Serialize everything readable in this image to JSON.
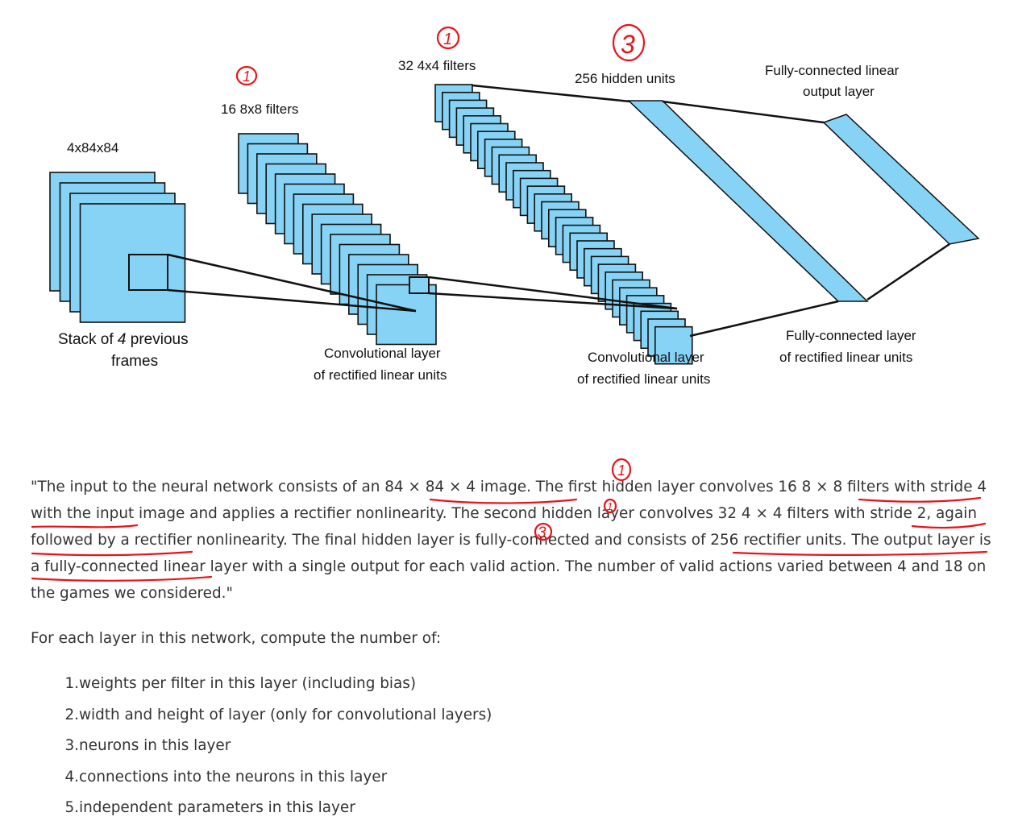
{
  "diagram": {
    "input_size_label": "4x84x84",
    "input_caption_line1_pre": "Stack of ",
    "input_caption_line1_em": "4",
    "input_caption_line1_post": " previous",
    "input_caption_line2": "frames",
    "conv1_filters_label": "16 8x8 filters",
    "conv1_caption_line1": "Convolutional layer",
    "conv1_caption_line2": "of rectified linear units",
    "conv2_filters_label": "32 4x4 filters",
    "conv2_caption_line1": "Convolutional layer",
    "conv2_caption_line2": "of rectified linear units",
    "fc_label": "256 hidden units",
    "fc_caption_line1": "Fully-connected layer",
    "fc_caption_line2": "of rectified linear units",
    "out_label_line1": "Fully-connected linear",
    "out_label_line2": "output layer",
    "layer_color": "#87d3f5",
    "annotation_color": "#e8141a"
  },
  "annotations": {
    "conv1_number": "1",
    "conv2_number": "1",
    "fc_number": "3",
    "quote_mark_conv1": "1",
    "quote_mark_conv2": "1",
    "quote_mark_fc": "3"
  },
  "quote": {
    "p1": "\"The input to the neural network consists of an ",
    "u1": "84 × 84 × 4 image",
    "p2": ". The first hidden layer convolves ",
    "u2": "16 8 × 8 filters with stride 4",
    "p3": " with the input image and applies a rectifier nonlinearity. The second hidden layer convolves ",
    "u3": "32 4 × 4 filters with stride 2",
    "p4": ", again followed by a rectifier nonlinearity. The final hidden layer ",
    "u4": "is fully-connected and consists of 256 rectifier units.",
    "p5": " The output layer is a fully-connected linear layer with a single output for each valid action. The number of valid actions varied between 4 and 18 on the games we considered.\""
  },
  "instruction": "For each layer in this network, compute the number of:",
  "questions": [
    {
      "num": "1.",
      "text": "weights per filter in this layer (including bias)"
    },
    {
      "num": "2.",
      "text": "width and height of layer (only for convolutional layers)"
    },
    {
      "num": "3.",
      "text": "neurons in this layer"
    },
    {
      "num": "4.",
      "text": "connections into the neurons in this layer"
    },
    {
      "num": "5.",
      "text": "independent parameters in this layer"
    }
  ]
}
